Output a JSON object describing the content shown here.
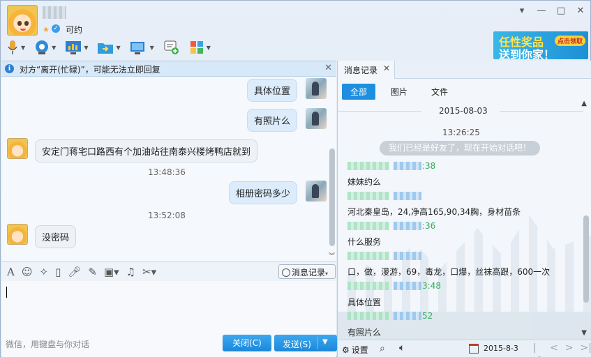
{
  "header": {
    "signature": "可约",
    "window_buttons": [
      "▾",
      "—",
      "□",
      "✕"
    ],
    "ad_line1": "任性奖品",
    "ad_line2": "送到你家！",
    "ad_button": "点击领取"
  },
  "notice": {
    "text": "对方“离开(忙碌)”，可能无法立即回复",
    "close": "✕"
  },
  "messages": [
    {
      "side": "me",
      "text": "具体位置"
    },
    {
      "side": "me",
      "text": "有照片么"
    },
    {
      "side": "her",
      "text": "安定门蒋宅口路西有个加油站往南泰兴楼烤鸭店就到"
    },
    {
      "time": "13:48:36"
    },
    {
      "side": "me",
      "text": "相册密码多少"
    },
    {
      "time": "13:52:08"
    },
    {
      "side": "her",
      "text": "没密码"
    }
  ],
  "input_toolbar": {
    "history_label": "消息记录"
  },
  "input": {
    "hint": "微信，用键盘与你对话",
    "close_label": "关闭(C)",
    "send_label": "发送(S)"
  },
  "history": {
    "tab_label": "消息记录",
    "filters": [
      "全部",
      "图片",
      "文件"
    ],
    "date": "2015-08-03",
    "first_time": "13:26:25",
    "system_pill": "我们已经是好友了，现在开始对话吧！",
    "entries": [
      {
        "time": ":38",
        "text": "妹妹约么"
      },
      {
        "time": "",
        "text": "河北秦皇岛，24,净高165,90,34胸，身材苗条"
      },
      {
        "time": ":36",
        "text": "什么服务"
      },
      {
        "time": "",
        "text": "口，做，漫游，69，毒龙，口爆，丝袜高跟，600一次"
      },
      {
        "time": "3:48",
        "text": "具体位置"
      },
      {
        "time": "52",
        "text": "有照片么"
      }
    ],
    "bottom": {
      "settings": "设置",
      "date": "2015-8-3"
    }
  }
}
